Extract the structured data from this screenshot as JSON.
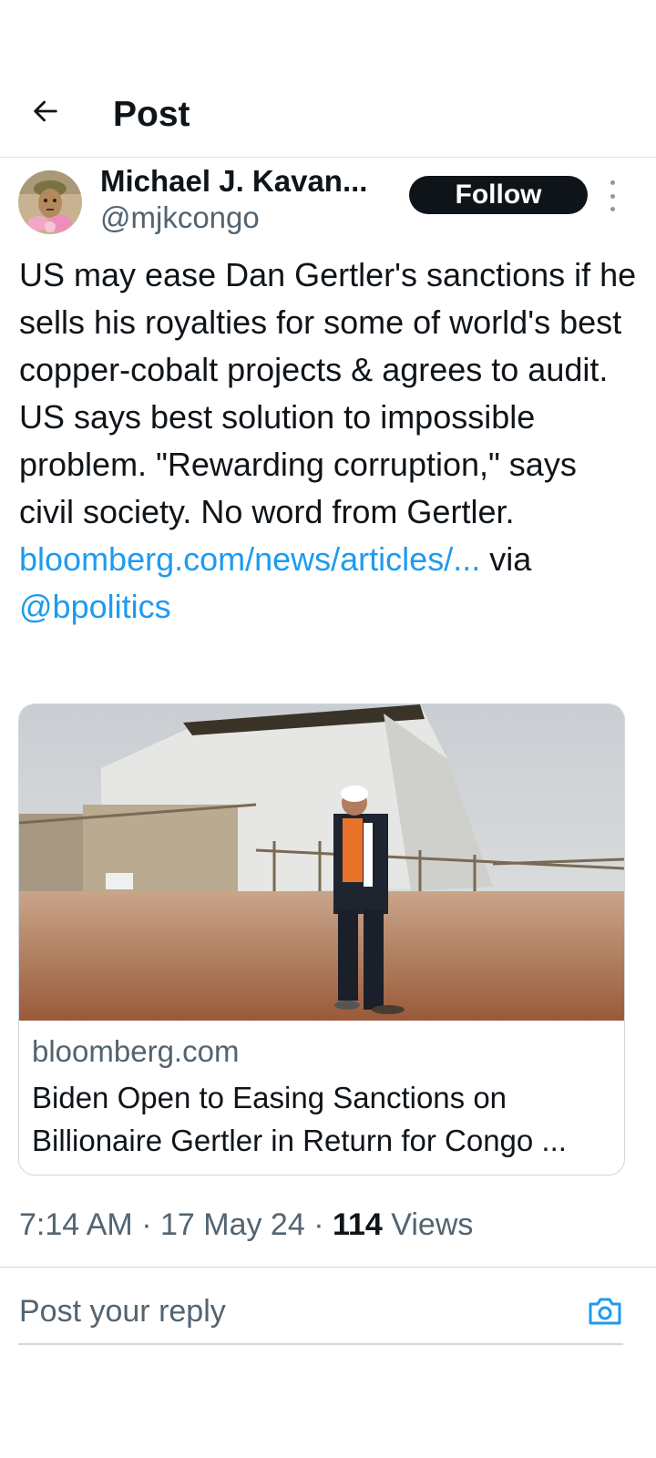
{
  "header": {
    "title": "Post",
    "back_icon": "arrow-left-icon"
  },
  "author": {
    "name": "Michael J. Kavan...",
    "handle": "@mjkcongo",
    "follow_label": "Follow",
    "more_icon": "more-vertical-icon"
  },
  "tweet": {
    "text": "US may ease Dan Gertler's sanctions if he sells his royalties for some of world's best copper-cobalt projects & agrees to audit. US says best solution to impossible problem. \"Rewarding corruption,\" says civil society. No word from Gertler.",
    "link_text": "bloomberg.com/news/articles/...",
    "via_text": "via",
    "mention": "@bpolitics"
  },
  "card": {
    "domain": "bloomberg.com",
    "title": "Biden Open to Easing Sanctions on Billionaire Gertler in Return for Congo ..."
  },
  "meta": {
    "time": "7:14 AM",
    "separator": "·",
    "date": "17 May 24",
    "views_count": "114",
    "views_label": "Views"
  },
  "reply": {
    "placeholder": "Post your reply",
    "camera_icon": "camera-icon"
  },
  "colors": {
    "link": "#1d9bf0",
    "text": "#0f1419",
    "secondary": "#536471",
    "border": "#cfd9de"
  }
}
